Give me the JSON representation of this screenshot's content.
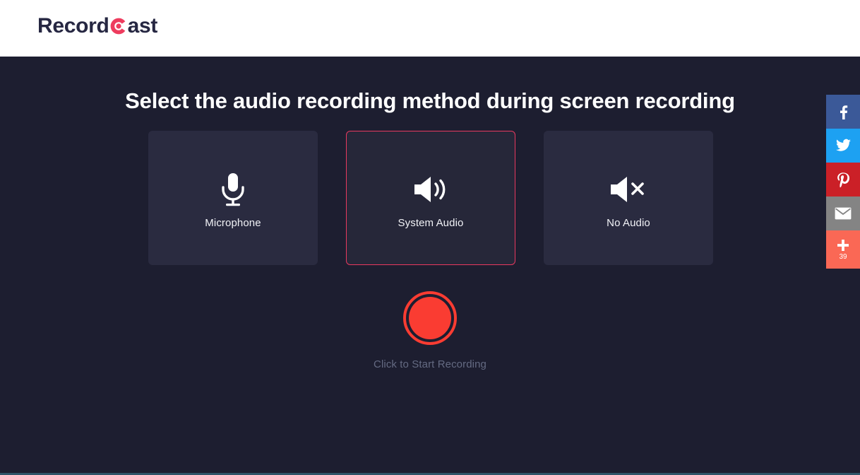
{
  "header": {
    "logo": {
      "text_before": "Record",
      "mark": "record-c-icon",
      "text_after": "ast",
      "full_text": "RecordCast",
      "text_color": "#262742",
      "mark_color": "#ee3c5e"
    },
    "background": "#ffffff"
  },
  "main": {
    "background": "#1d1e30",
    "headline": "Select the audio recording method during screen recording",
    "options": [
      {
        "id": "microphone",
        "label": "Microphone",
        "icon": "microphone-icon",
        "selected": false
      },
      {
        "id": "system-audio",
        "label": "System Audio",
        "icon": "speaker-volume-icon",
        "selected": true
      },
      {
        "id": "no-audio",
        "label": "No Audio",
        "icon": "speaker-mute-icon",
        "selected": false
      }
    ],
    "selected_option_border_color": "#e8395f",
    "record": {
      "button_name": "record-button",
      "caption": "Click to Start Recording",
      "button_color": "#fa3c32",
      "caption_color": "#646a82"
    }
  },
  "social_rail": {
    "items": [
      {
        "id": "facebook",
        "icon": "facebook-icon",
        "label": "Facebook",
        "color": "#3b5998"
      },
      {
        "id": "twitter",
        "icon": "twitter-icon",
        "label": "Twitter",
        "color": "#1da1f2"
      },
      {
        "id": "pinterest",
        "icon": "pinterest-icon",
        "label": "Pinterest",
        "color": "#cb2027"
      },
      {
        "id": "email",
        "icon": "envelope-icon",
        "label": "Email",
        "color": "#848484"
      },
      {
        "id": "more",
        "icon": "plus-icon",
        "label": "More",
        "color": "#fa6855",
        "count": "39"
      }
    ]
  },
  "footer": {
    "rule_color": "#2f5468"
  }
}
